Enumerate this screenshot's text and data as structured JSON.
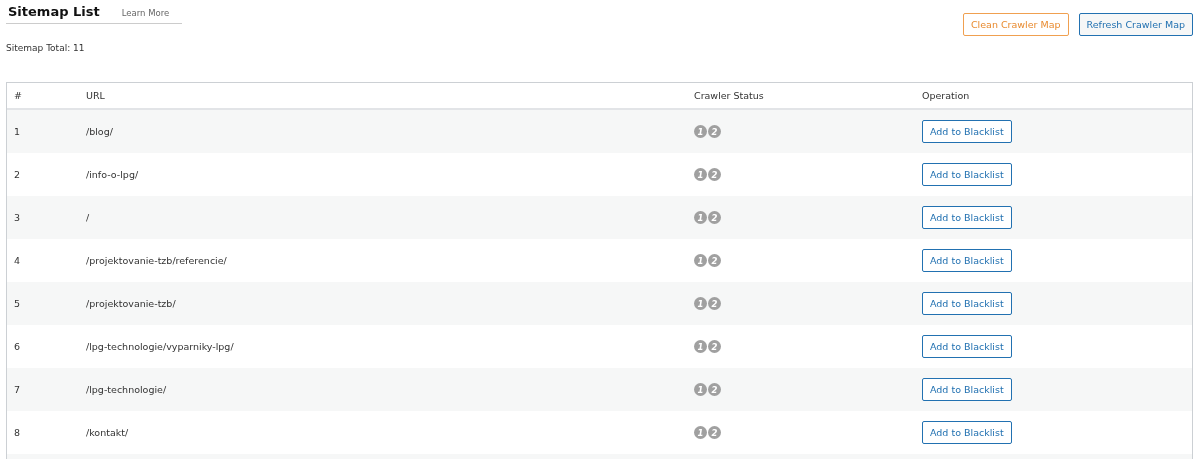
{
  "title": "Sitemap List",
  "learn_more": "Learn More",
  "buttons": [
    {
      "label": "Clean Crawler Map",
      "kind": "warning"
    },
    {
      "label": "Refresh Crawler Map",
      "kind": "primary"
    }
  ],
  "total": "Sitemap Total: 11",
  "table": {
    "columns": [
      "#",
      "URL",
      "Crawler Status",
      "Operation"
    ],
    "rows": [
      {
        "num": "1",
        "url": "/blog/",
        "status": [
          "1",
          "2"
        ],
        "action": "Add to Blacklist"
      },
      {
        "num": "2",
        "url": "/info-o-lpg/",
        "status": [
          "1",
          "2"
        ],
        "action": "Add to Blacklist"
      },
      {
        "num": "3",
        "url": "/",
        "status": [
          "1",
          "2"
        ],
        "action": "Add to Blacklist"
      },
      {
        "num": "4",
        "url": "/projektovanie-tzb/referencie/",
        "status": [
          "1",
          "2"
        ],
        "action": "Add to Blacklist"
      },
      {
        "num": "5",
        "url": "/projektovanie-tzb/",
        "status": [
          "1",
          "2"
        ],
        "action": "Add to Blacklist"
      },
      {
        "num": "6",
        "url": "/lpg-technologie/vyparniky-lpg/",
        "status": [
          "1",
          "2"
        ],
        "action": "Add to Blacklist"
      },
      {
        "num": "7",
        "url": "/lpg-technologie/",
        "status": [
          "1",
          "2"
        ],
        "action": "Add to Blacklist"
      },
      {
        "num": "8",
        "url": "/kontakt/",
        "status": [
          "1",
          "2"
        ],
        "action": "Add to Blacklist"
      }
    ]
  }
}
